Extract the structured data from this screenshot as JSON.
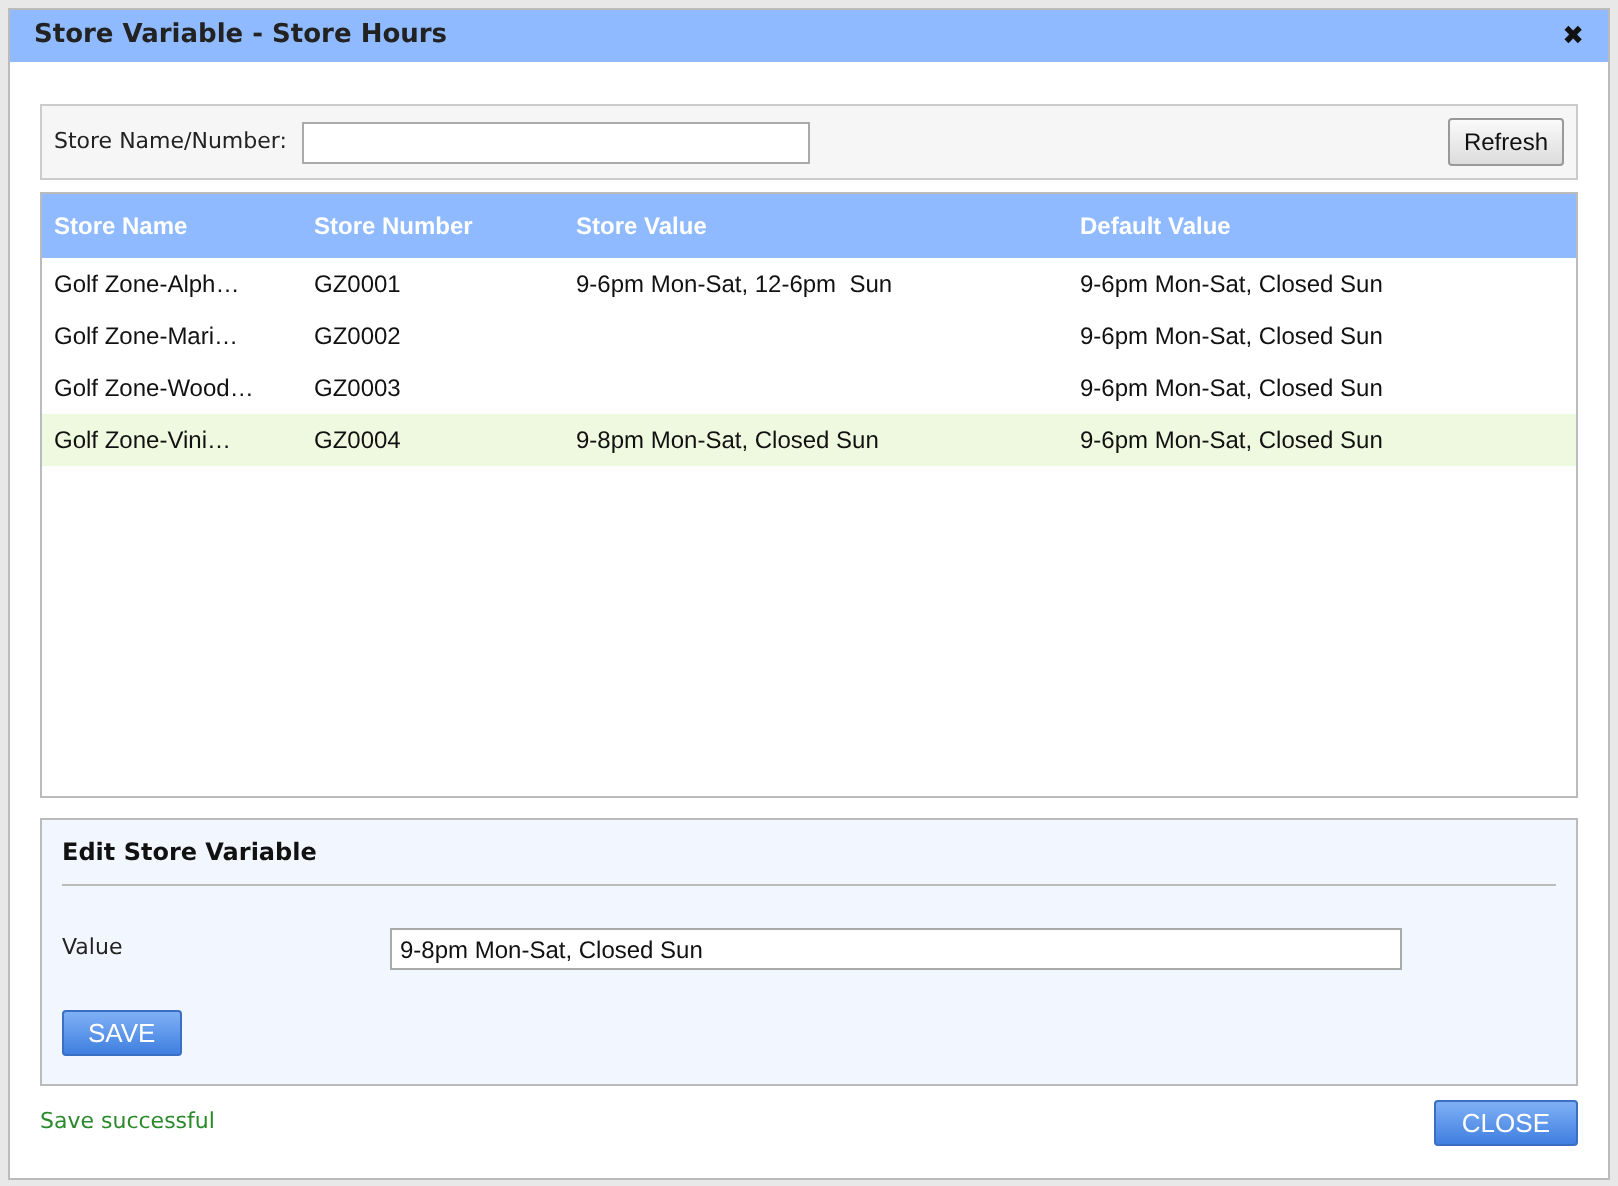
{
  "window": {
    "title": "Store Variable - Store Hours",
    "close": "✖"
  },
  "filter": {
    "label": "Store Name/Number:",
    "refresh": "Refresh"
  },
  "table": {
    "columns": [
      "Store Name",
      "Store Number",
      "Store Value",
      "Default Value"
    ],
    "rows": [
      {
        "name": "Golf Zone-Alph…",
        "number": "GZ0001",
        "store_value": "9-6pm Mon-Sat, 12-6pm  Sun",
        "default_value": "9-6pm Mon-Sat, Closed Sun",
        "selected": false
      },
      {
        "name": "Golf Zone-Mari…",
        "number": "GZ0002",
        "default_value": "9-6pm Mon-Sat, Closed Sun",
        "selected": false
      },
      {
        "name": "Golf Zone-Wood…",
        "number": "GZ0003",
        "default_value": "9-6pm Mon-Sat, Closed Sun",
        "selected": false
      },
      {
        "name": "Golf Zone-Vini…",
        "number": "GZ0004",
        "store_value": "9-8pm Mon-Sat, Closed Sun",
        "default_value": "9-6pm Mon-Sat, Closed Sun",
        "selected": true
      }
    ]
  },
  "edit": {
    "title": "Edit Store Variable",
    "label": "Value",
    "value": "9-8pm Mon-Sat, Closed Sun",
    "save": "SAVE"
  },
  "status": "Save successful",
  "close_button": "CLOSE"
}
